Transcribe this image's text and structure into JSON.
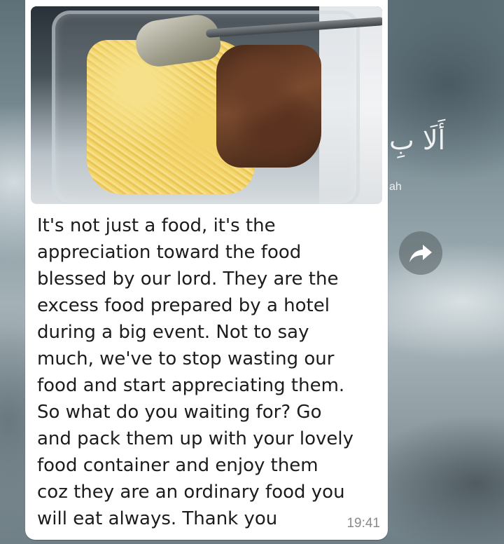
{
  "message": {
    "lines": [
      "It's not just a food, it's the",
      "appreciation toward the food",
      "blessed by our lord. They are the",
      "excess food prepared by a hotel",
      "during a big event. Not to say",
      "much, we've to stop wasting our",
      "food and start appreciating them.",
      "So what do you waiting for? Go",
      "and pack them up with your lovely",
      "food container and enjoy them",
      "coz they are an ordinary food you",
      "will eat always. Thank you"
    ],
    "time": "19:41",
    "image_icon": "food-photo"
  },
  "wallpaper": {
    "arabic_text": "أَلَا بِ",
    "small_text": "ah"
  },
  "forward_icon": "forward-arrow-icon",
  "colors": {
    "bubble": "#ffffff",
    "text": "#1c1c1c",
    "timestamp": "#8a8a8a"
  }
}
